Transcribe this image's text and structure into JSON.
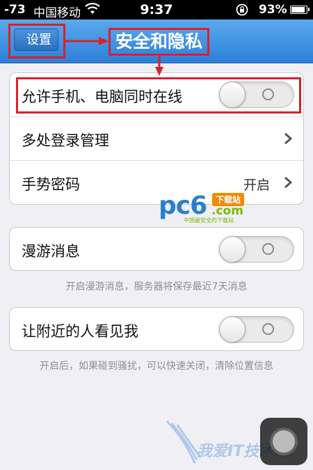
{
  "status_bar": {
    "signal": "-73",
    "carrier": "中国移动",
    "time": "9:37",
    "battery_percent": "93%",
    "battery_level": 0.93
  },
  "nav": {
    "back_label": "设置",
    "title": "安全和隐私"
  },
  "groups": [
    {
      "rows": [
        {
          "label": "允许手机、电脑同时在线",
          "type": "toggle",
          "on": false
        },
        {
          "label": "多处登录管理",
          "type": "chevron"
        },
        {
          "label": "手势密码",
          "type": "chevron",
          "value": "开启"
        }
      ]
    },
    {
      "rows": [
        {
          "label": "漫游消息",
          "type": "toggle",
          "on": false
        }
      ],
      "note": "开启漫游消息，服务器将保存最近7天消息"
    },
    {
      "rows": [
        {
          "label": "让附近的人看见我",
          "type": "toggle",
          "on": false
        }
      ],
      "note": "开启后，如果碰到骚扰，可以快速关闭，清除位置信息"
    }
  ],
  "watermarks": {
    "pc6_logo": "pc6",
    "pc6_badge": "下载站",
    "pc6_com": ".com",
    "pc6_sub": "中国最安全的下载站",
    "bottom": "我爱IT技术网"
  },
  "colors": {
    "navbar": "#3a8de0",
    "annotation": "#d9202e",
    "background": "#efeff4"
  }
}
